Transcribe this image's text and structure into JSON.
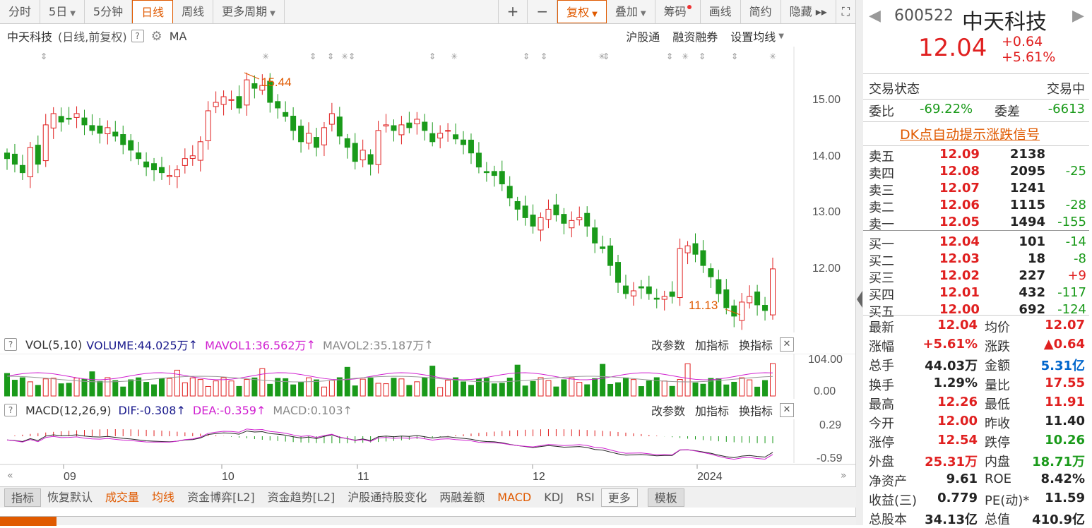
{
  "toolbar": {
    "items": [
      "分时",
      "5日",
      "5分钟",
      "日线",
      "周线",
      "更多周期"
    ],
    "plus": "+",
    "minus": "−",
    "fuquan": "复权",
    "diejia": "叠加",
    "chouma": "筹码",
    "huaxian": "画线",
    "jianyue": "简约",
    "yincang": "隐藏 ▸▸"
  },
  "subbar": {
    "title": "中天科技",
    "mode": "(日线,前复权)",
    "ma": "MA",
    "right": [
      "沪股通",
      "融资融券",
      "设置均线"
    ]
  },
  "price_axis": [
    "15.00",
    "14.00",
    "13.00",
    "12.00"
  ],
  "annotations": {
    "high": "15.44",
    "low": "11.13"
  },
  "vol": {
    "label": "VOL(5,10)",
    "volume": "VOLUME:44.025万",
    "mavol1": "MAVOL1:36.562万",
    "mavol2": "MAVOL2:35.187万",
    "axis_top": "104.00",
    "axis_bottom": "0.00"
  },
  "macd": {
    "label": "MACD(12,26,9)",
    "dif": "DIF:-0.308",
    "dea": "DEA:-0.359",
    "macd": "MACD:0.103",
    "axis_top": "0.29",
    "axis_bottom": "-0.59"
  },
  "ind_buttons": [
    "改参数",
    "加指标",
    "换指标"
  ],
  "dates": [
    "09",
    "10",
    "11",
    "12",
    "2024"
  ],
  "tabs": [
    "指标",
    "恢复默认",
    "成交量",
    "均线",
    "资金博弈[L2]",
    "资金趋势[L2]",
    "沪股通持股变化",
    "两融差额",
    "MACD",
    "KDJ",
    "RSI",
    "更多",
    "模板"
  ],
  "stock": {
    "code": "600522",
    "name": "中天科技",
    "price": "12.04",
    "change": "+0.64",
    "pct": "+5.61%"
  },
  "trade": {
    "status_label": "交易状态",
    "status": "交易中",
    "weibi_label": "委比",
    "weibi": "-69.22%",
    "weicha_label": "委差",
    "weicha": "-6613",
    "dk": "DK点自动提示涨跌信号"
  },
  "asks": [
    {
      "label": "卖五",
      "price": "12.09",
      "vol": "2138",
      "chg": ""
    },
    {
      "label": "卖四",
      "price": "12.08",
      "vol": "2095",
      "chg": "-25"
    },
    {
      "label": "卖三",
      "price": "12.07",
      "vol": "1241",
      "chg": ""
    },
    {
      "label": "卖二",
      "price": "12.06",
      "vol": "1115",
      "chg": "-28"
    },
    {
      "label": "卖一",
      "price": "12.05",
      "vol": "1494",
      "chg": "-155"
    }
  ],
  "bids": [
    {
      "label": "买一",
      "price": "12.04",
      "vol": "101",
      "chg": "-14"
    },
    {
      "label": "买二",
      "price": "12.03",
      "vol": "18",
      "chg": "-8"
    },
    {
      "label": "买三",
      "price": "12.02",
      "vol": "227",
      "chg": "+9"
    },
    {
      "label": "买四",
      "price": "12.01",
      "vol": "432",
      "chg": "-117"
    },
    {
      "label": "买五",
      "price": "12.00",
      "vol": "692",
      "chg": "-124"
    }
  ],
  "stats": [
    {
      "l1": "最新",
      "v1": "12.04",
      "c1": "red",
      "l2": "均价",
      "v2": "12.07",
      "c2": "red"
    },
    {
      "l1": "涨幅",
      "v1": "+5.61%",
      "c1": "red",
      "l2": "涨跌",
      "v2": "▲0.64",
      "c2": "red"
    },
    {
      "l1": "总手",
      "v1": "44.03万",
      "c1": "",
      "l2": "金额",
      "v2": "5.31亿",
      "c2": "blue"
    },
    {
      "l1": "换手",
      "v1": "1.29%",
      "c1": "",
      "l2": "量比",
      "v2": "17.55",
      "c2": "red"
    },
    {
      "l1": "最高",
      "v1": "12.26",
      "c1": "red",
      "l2": "最低",
      "v2": "11.91",
      "c2": "red"
    },
    {
      "l1": "今开",
      "v1": "12.00",
      "c1": "red",
      "l2": "昨收",
      "v2": "11.40",
      "c2": ""
    },
    {
      "l1": "涨停",
      "v1": "12.54",
      "c1": "red",
      "l2": "跌停",
      "v2": "10.26",
      "c2": "green"
    },
    {
      "l1": "外盘",
      "v1": "25.31万",
      "c1": "red",
      "l2": "内盘",
      "v2": "18.71万",
      "c2": "green"
    },
    {
      "l1": "净资产",
      "v1": "9.61",
      "c1": "",
      "l2": "ROE",
      "v2": "8.42%",
      "c2": ""
    },
    {
      "l1": "收益(三)",
      "v1": "0.779",
      "c1": "",
      "l2": "PE(动)*",
      "v2": "11.59",
      "c2": ""
    },
    {
      "l1": "总股本",
      "v1": "34.13亿",
      "c1": "",
      "l2": "总值",
      "v2": "410.9亿",
      "c2": ""
    }
  ],
  "colors": {
    "up": "#e02020",
    "down": "#1a9a1a",
    "accent": "#e05a00"
  }
}
